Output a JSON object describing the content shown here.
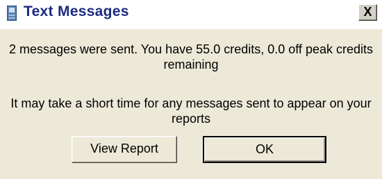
{
  "window": {
    "title": "Text Messages",
    "close_label": "X"
  },
  "body": {
    "message1": "2 messages were sent. You have 55.0 credits, 0.0 off peak credits remaining",
    "message2": "It may take a short time for any messages sent to appear on your reports"
  },
  "buttons": {
    "view_report": "View Report",
    "ok": "OK"
  },
  "icons": {
    "app_icon": "mobile-phone-icon"
  },
  "colors": {
    "title_text": "#1c2b80",
    "dialog_background": "#ece9d8"
  }
}
